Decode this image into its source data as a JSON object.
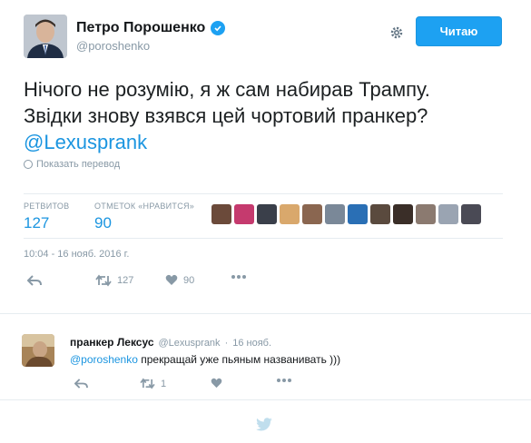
{
  "tweet": {
    "author_name": "Петро Порошенко",
    "author_handle": "@poroshenko",
    "follow_label": "Читаю",
    "text_line1": "Нічого не розумію, я ж сам набирав Трампу.",
    "text_line2": "Звідки знову взявся цей чортовий пранкер?",
    "mention": "@Lexusprank",
    "translate_label": "Показать перевод",
    "retweets_label": "РЕТВИТОВ",
    "retweets_count": "127",
    "likes_label": "ОТМЕТОК «НРАВИТСЯ»",
    "likes_count": "90",
    "timestamp": "10:04 - 16 нояб. 2016 г.",
    "action_retweet_count": "127",
    "action_like_count": "90",
    "liker_colors": [
      "#6b4a3a",
      "#c53a6e",
      "#3a3f4a",
      "#d9a86c",
      "#8a6650",
      "#7a8898",
      "#2a6fb5",
      "#5a4a3e",
      "#3a2e28",
      "#8b7a70",
      "#9aa4b2",
      "#4a4a55"
    ]
  },
  "reply": {
    "author_name": "пранкер Лексус",
    "author_handle": "@Lexusprank",
    "date": "16 нояб.",
    "mention": "@poroshenko",
    "text": "прекращай уже пьяным названивать )))",
    "retweet_count": "1"
  },
  "colors": {
    "accent": "#1da1f2",
    "link": "#1b95e0",
    "muted": "#8899a6"
  }
}
